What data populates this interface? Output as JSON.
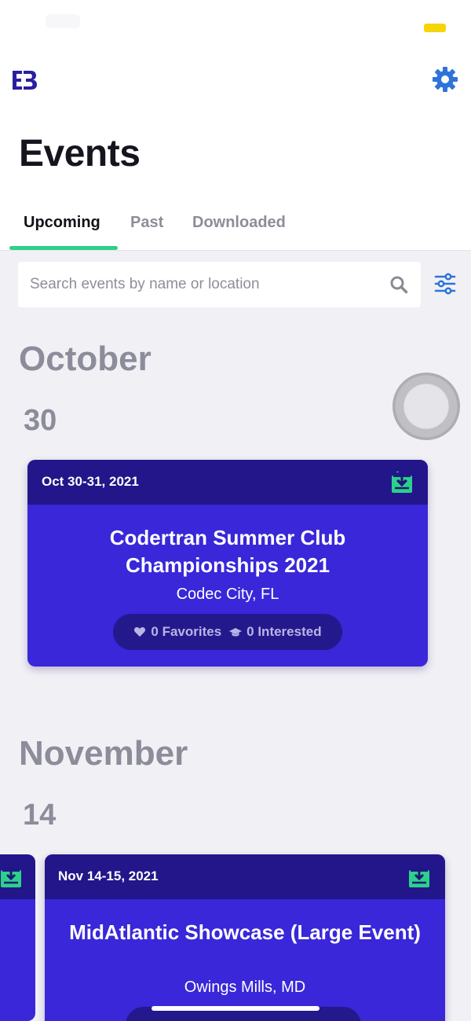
{
  "header": {
    "title": "Events"
  },
  "tabs": [
    {
      "label": "Upcoming",
      "active": true
    },
    {
      "label": "Past",
      "active": false
    },
    {
      "label": "Downloaded",
      "active": false
    }
  ],
  "search": {
    "placeholder": "Search events by name or location",
    "value": ""
  },
  "sections": [
    {
      "month": "October",
      "day": "30",
      "events": [
        {
          "date": "Oct 30-31, 2021",
          "title": "Codertran Summer Club Championships 2021",
          "location": "Codec City, FL",
          "favorites": "0 Favorites",
          "interested": "0 Interested"
        }
      ]
    },
    {
      "month": "November",
      "day": "14",
      "events": [
        {
          "date": "Nov 14-15, 2021",
          "title": "MidAtlantic Showcase (Large Event)",
          "location": "Owings Mills, MD"
        }
      ]
    }
  ],
  "colors": {
    "brand": "#3927d9",
    "brand_dark": "#22168a",
    "accent": "#2bd18a",
    "settings_blue": "#2f73d9"
  },
  "icons": [
    "eb-logo",
    "gear-icon",
    "search-icon",
    "filter-icon",
    "download-icon",
    "heart-icon",
    "graduation-cap-icon"
  ]
}
